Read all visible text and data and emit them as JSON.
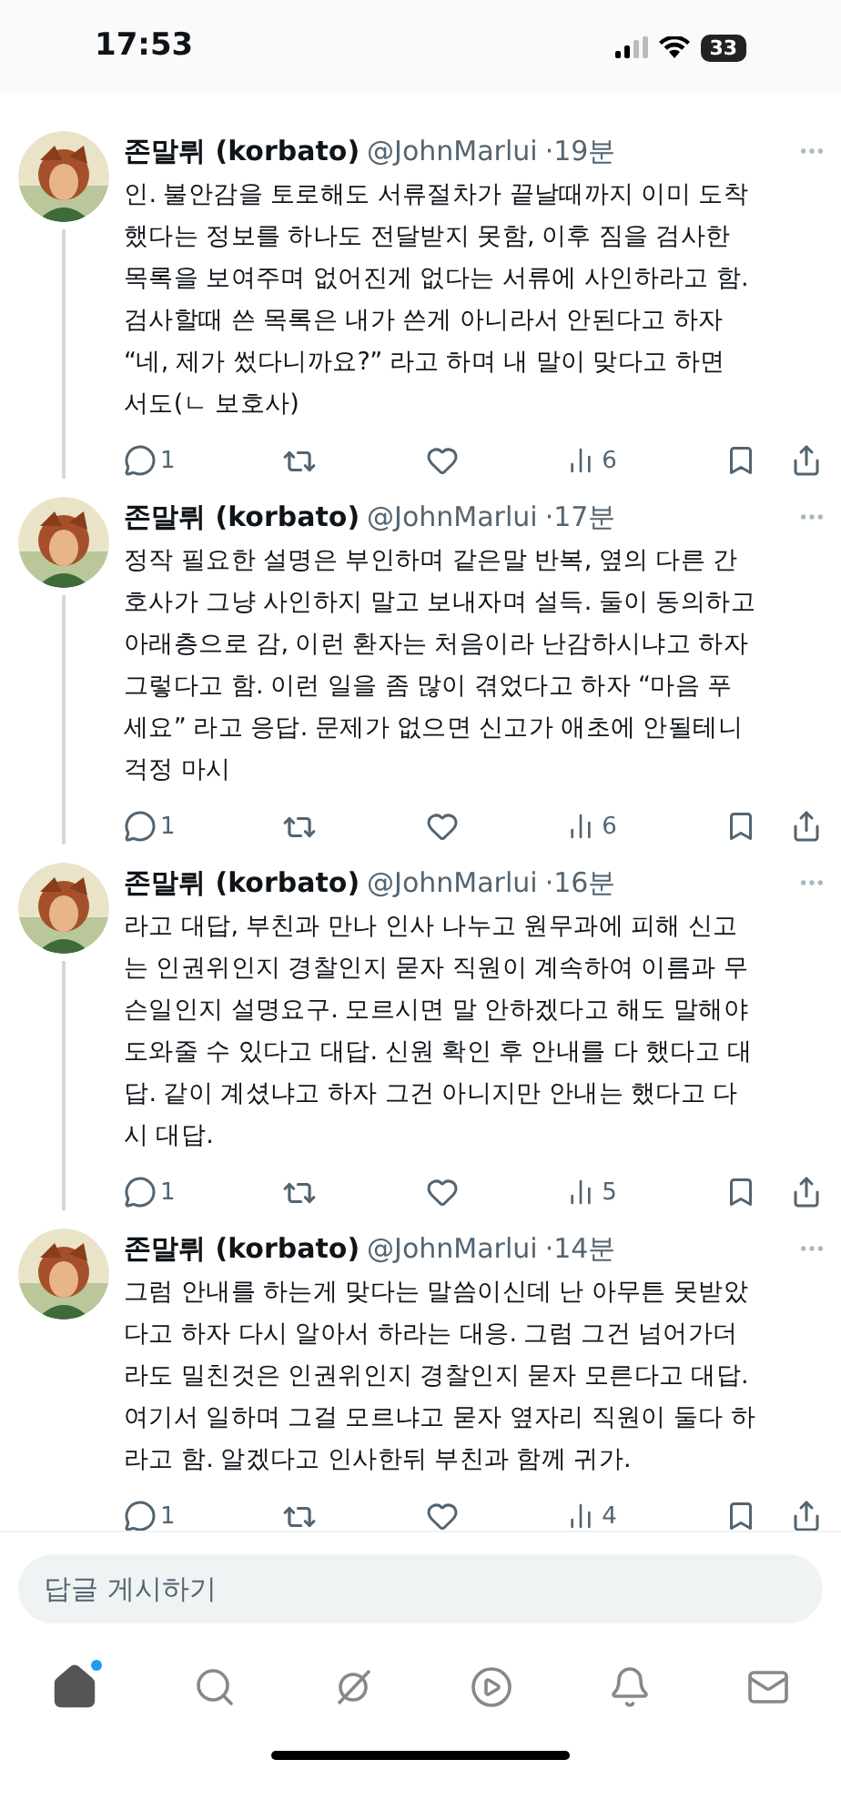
{
  "status_bar": {
    "time": "17:53",
    "battery": "33"
  },
  "posts": [
    {
      "name": "존말뤼 (korbato)",
      "handle": "@JohnMarlui",
      "time": "·19분",
      "text": "인. 불안감을 토로해도 서류절차가 끝날때까지 이미 도착\n했다는 정보를 하나도 전달받지 못함, 이후 짐을 검사한\n목록을 보여주며 없어진게 없다는 서류에 사인하라고 함.\n검사할때 쓴 목록은 내가 쓴게 아니라서 안된다고 하자\n“네, 제가 썼다니까요?” 라고 하며 내 말이 맞다고 하면\n서도(ㄴ 보호사)",
      "replies": "1",
      "views": "6"
    },
    {
      "name": "존말뤼 (korbato)",
      "handle": "@JohnMarlui",
      "time": "·17분",
      "text": "정작 필요한 설명은 부인하며 같은말 반복, 옆의 다른 간\n호사가 그냥 사인하지 말고 보내자며 설득. 둘이 동의하고\n아래층으로 감, 이런 환자는 처음이라 난감하시냐고 하자\n그렇다고 함. 이런 일을 좀 많이 겪었다고 하자 “마음 푸\n세요” 라고 응답. 문제가 없으면 신고가 애초에 안될테니\n걱정 마시",
      "replies": "1",
      "views": "6"
    },
    {
      "name": "존말뤼 (korbato)",
      "handle": "@JohnMarlui",
      "time": "·16분",
      "text": "라고 대답, 부친과 만나 인사 나누고 원무과에 피해 신고\n는 인권위인지 경찰인지 묻자 직원이 계속하여 이름과 무\n슨일인지 설명요구. 모르시면 말 안하겠다고 해도 말해야\n도와줄 수 있다고 대답. 신원 확인 후 안내를 다 했다고 대\n답. 같이 계셨냐고 하자 그건 아니지만 안내는 했다고 다\n시 대답.",
      "replies": "1",
      "views": "5"
    },
    {
      "name": "존말뤼 (korbato)",
      "handle": "@JohnMarlui",
      "time": "·14분",
      "text": "그럼 안내를 하는게 맞다는 말씀이신데 난 아무튼 못받았\n다고 하자 다시 알아서 하라는 대응. 그럼 그건 넘어가더\n라도 밀친것은 인권위인지 경찰인지 묻자 모른다고 대답.\n여기서 일하며 그걸 모르냐고 묻자 옆자리 직원이 둘다 하\n라고 함. 알겠다고 인사한뒤 부친과 함께 귀가.",
      "replies": "1",
      "views": "4"
    }
  ],
  "reply_field": {
    "placeholder": "답글 게시하기"
  },
  "nav": [
    {
      "kind": "home",
      "selected": true,
      "dot": true
    },
    {
      "kind": "search",
      "selected": false,
      "dot": false
    },
    {
      "kind": "grok",
      "selected": false,
      "dot": false
    },
    {
      "kind": "video",
      "selected": false,
      "dot": false
    },
    {
      "kind": "bell",
      "selected": false,
      "dot": false
    },
    {
      "kind": "mail",
      "selected": false,
      "dot": false
    }
  ]
}
